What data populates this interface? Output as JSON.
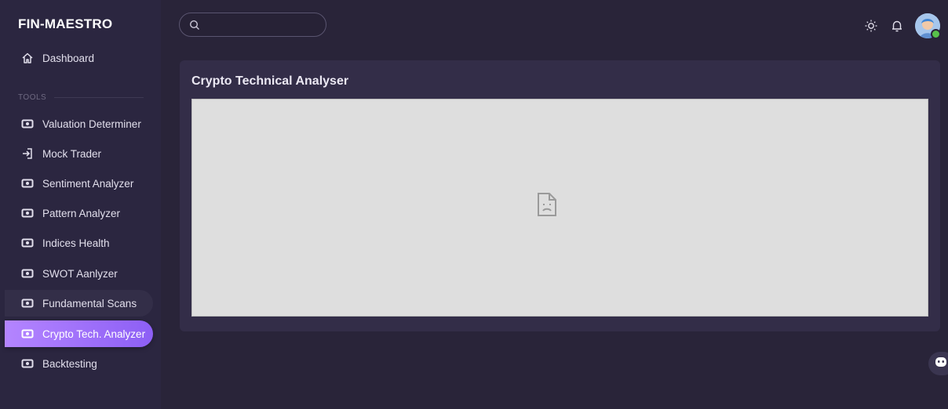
{
  "sidebar": {
    "brand": "FIN-MAESTRO",
    "dashboard_label": "Dashboard",
    "section_label": "TOOLS",
    "items": [
      {
        "label": "Valuation Determiner",
        "icon": "eye-box-icon"
      },
      {
        "label": "Mock Trader",
        "icon": "login-icon"
      },
      {
        "label": "Sentiment Analyzer",
        "icon": "eye-box-icon"
      },
      {
        "label": "Pattern Analyzer",
        "icon": "eye-box-icon"
      },
      {
        "label": "Indices Health",
        "icon": "eye-box-icon"
      },
      {
        "label": "SWOT Aanlyzer",
        "icon": "eye-box-icon"
      },
      {
        "label": "Fundamental Scans",
        "icon": "eye-box-icon"
      },
      {
        "label": "Crypto Tech. Analyzer",
        "icon": "eye-box-icon"
      },
      {
        "label": "Backtesting",
        "icon": "eye-box-icon"
      }
    ],
    "active_item": "Crypto Tech. Analyzer",
    "hovered_item": "Fundamental Scans"
  },
  "header": {
    "search": {
      "value": "",
      "placeholder": ""
    },
    "icons": [
      "theme-toggle-icon",
      "bell-icon",
      "avatar"
    ]
  },
  "main": {
    "title": "Crypto Technical Analyser",
    "embed_state": "broken-page-icon"
  },
  "colors": {
    "background": "#292439",
    "sidebar": "#2b2640",
    "card": "#332d48",
    "accent_start": "#b485ff",
    "accent_end": "#8d5ff5",
    "online": "#58c24a"
  }
}
